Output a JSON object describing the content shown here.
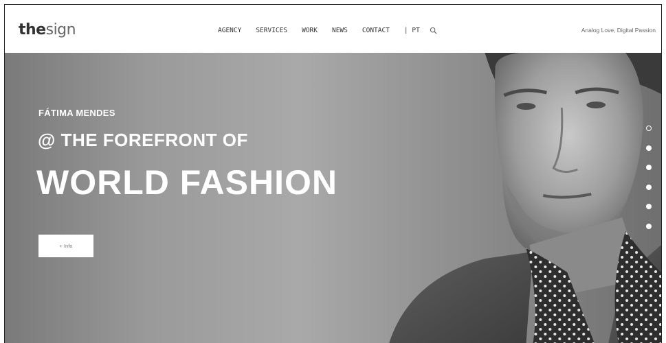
{
  "brand": {
    "logo_bold": "the",
    "logo_light": "sign"
  },
  "nav": {
    "items": [
      "AGENCY",
      "SERVICES",
      "WORK",
      "NEWS",
      "CONTACT"
    ],
    "language": "| PT",
    "search_icon": "search-icon"
  },
  "tagline": "Analog Love, Digital Passion",
  "hero": {
    "kicker": "FÁTIMA MENDES",
    "headline_small": "@ THE FOREFRONT OF",
    "headline_large": "WORLD FASHION",
    "button_label": "+ Info"
  },
  "slider": {
    "total": 6,
    "active_index": 0
  },
  "colors": {
    "header_bg": "#ffffff",
    "hero_tone": "#9a9a9a",
    "text_light": "#ffffff"
  }
}
